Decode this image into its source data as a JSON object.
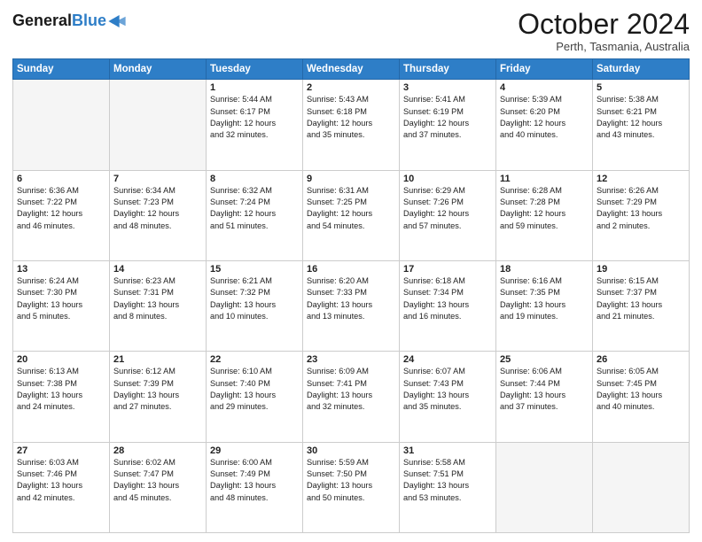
{
  "logo": {
    "line1": "General",
    "line2": "Blue",
    "icon": "▶"
  },
  "header": {
    "month": "October 2024",
    "location": "Perth, Tasmania, Australia"
  },
  "weekdays": [
    "Sunday",
    "Monday",
    "Tuesday",
    "Wednesday",
    "Thursday",
    "Friday",
    "Saturday"
  ],
  "weeks": [
    [
      {
        "day": "",
        "info": ""
      },
      {
        "day": "",
        "info": ""
      },
      {
        "day": "1",
        "info": "Sunrise: 5:44 AM\nSunset: 6:17 PM\nDaylight: 12 hours\nand 32 minutes."
      },
      {
        "day": "2",
        "info": "Sunrise: 5:43 AM\nSunset: 6:18 PM\nDaylight: 12 hours\nand 35 minutes."
      },
      {
        "day": "3",
        "info": "Sunrise: 5:41 AM\nSunset: 6:19 PM\nDaylight: 12 hours\nand 37 minutes."
      },
      {
        "day": "4",
        "info": "Sunrise: 5:39 AM\nSunset: 6:20 PM\nDaylight: 12 hours\nand 40 minutes."
      },
      {
        "day": "5",
        "info": "Sunrise: 5:38 AM\nSunset: 6:21 PM\nDaylight: 12 hours\nand 43 minutes."
      }
    ],
    [
      {
        "day": "6",
        "info": "Sunrise: 6:36 AM\nSunset: 7:22 PM\nDaylight: 12 hours\nand 46 minutes."
      },
      {
        "day": "7",
        "info": "Sunrise: 6:34 AM\nSunset: 7:23 PM\nDaylight: 12 hours\nand 48 minutes."
      },
      {
        "day": "8",
        "info": "Sunrise: 6:32 AM\nSunset: 7:24 PM\nDaylight: 12 hours\nand 51 minutes."
      },
      {
        "day": "9",
        "info": "Sunrise: 6:31 AM\nSunset: 7:25 PM\nDaylight: 12 hours\nand 54 minutes."
      },
      {
        "day": "10",
        "info": "Sunrise: 6:29 AM\nSunset: 7:26 PM\nDaylight: 12 hours\nand 57 minutes."
      },
      {
        "day": "11",
        "info": "Sunrise: 6:28 AM\nSunset: 7:28 PM\nDaylight: 12 hours\nand 59 minutes."
      },
      {
        "day": "12",
        "info": "Sunrise: 6:26 AM\nSunset: 7:29 PM\nDaylight: 13 hours\nand 2 minutes."
      }
    ],
    [
      {
        "day": "13",
        "info": "Sunrise: 6:24 AM\nSunset: 7:30 PM\nDaylight: 13 hours\nand 5 minutes."
      },
      {
        "day": "14",
        "info": "Sunrise: 6:23 AM\nSunset: 7:31 PM\nDaylight: 13 hours\nand 8 minutes."
      },
      {
        "day": "15",
        "info": "Sunrise: 6:21 AM\nSunset: 7:32 PM\nDaylight: 13 hours\nand 10 minutes."
      },
      {
        "day": "16",
        "info": "Sunrise: 6:20 AM\nSunset: 7:33 PM\nDaylight: 13 hours\nand 13 minutes."
      },
      {
        "day": "17",
        "info": "Sunrise: 6:18 AM\nSunset: 7:34 PM\nDaylight: 13 hours\nand 16 minutes."
      },
      {
        "day": "18",
        "info": "Sunrise: 6:16 AM\nSunset: 7:35 PM\nDaylight: 13 hours\nand 19 minutes."
      },
      {
        "day": "19",
        "info": "Sunrise: 6:15 AM\nSunset: 7:37 PM\nDaylight: 13 hours\nand 21 minutes."
      }
    ],
    [
      {
        "day": "20",
        "info": "Sunrise: 6:13 AM\nSunset: 7:38 PM\nDaylight: 13 hours\nand 24 minutes."
      },
      {
        "day": "21",
        "info": "Sunrise: 6:12 AM\nSunset: 7:39 PM\nDaylight: 13 hours\nand 27 minutes."
      },
      {
        "day": "22",
        "info": "Sunrise: 6:10 AM\nSunset: 7:40 PM\nDaylight: 13 hours\nand 29 minutes."
      },
      {
        "day": "23",
        "info": "Sunrise: 6:09 AM\nSunset: 7:41 PM\nDaylight: 13 hours\nand 32 minutes."
      },
      {
        "day": "24",
        "info": "Sunrise: 6:07 AM\nSunset: 7:43 PM\nDaylight: 13 hours\nand 35 minutes."
      },
      {
        "day": "25",
        "info": "Sunrise: 6:06 AM\nSunset: 7:44 PM\nDaylight: 13 hours\nand 37 minutes."
      },
      {
        "day": "26",
        "info": "Sunrise: 6:05 AM\nSunset: 7:45 PM\nDaylight: 13 hours\nand 40 minutes."
      }
    ],
    [
      {
        "day": "27",
        "info": "Sunrise: 6:03 AM\nSunset: 7:46 PM\nDaylight: 13 hours\nand 42 minutes."
      },
      {
        "day": "28",
        "info": "Sunrise: 6:02 AM\nSunset: 7:47 PM\nDaylight: 13 hours\nand 45 minutes."
      },
      {
        "day": "29",
        "info": "Sunrise: 6:00 AM\nSunset: 7:49 PM\nDaylight: 13 hours\nand 48 minutes."
      },
      {
        "day": "30",
        "info": "Sunrise: 5:59 AM\nSunset: 7:50 PM\nDaylight: 13 hours\nand 50 minutes."
      },
      {
        "day": "31",
        "info": "Sunrise: 5:58 AM\nSunset: 7:51 PM\nDaylight: 13 hours\nand 53 minutes."
      },
      {
        "day": "",
        "info": ""
      },
      {
        "day": "",
        "info": ""
      }
    ]
  ]
}
